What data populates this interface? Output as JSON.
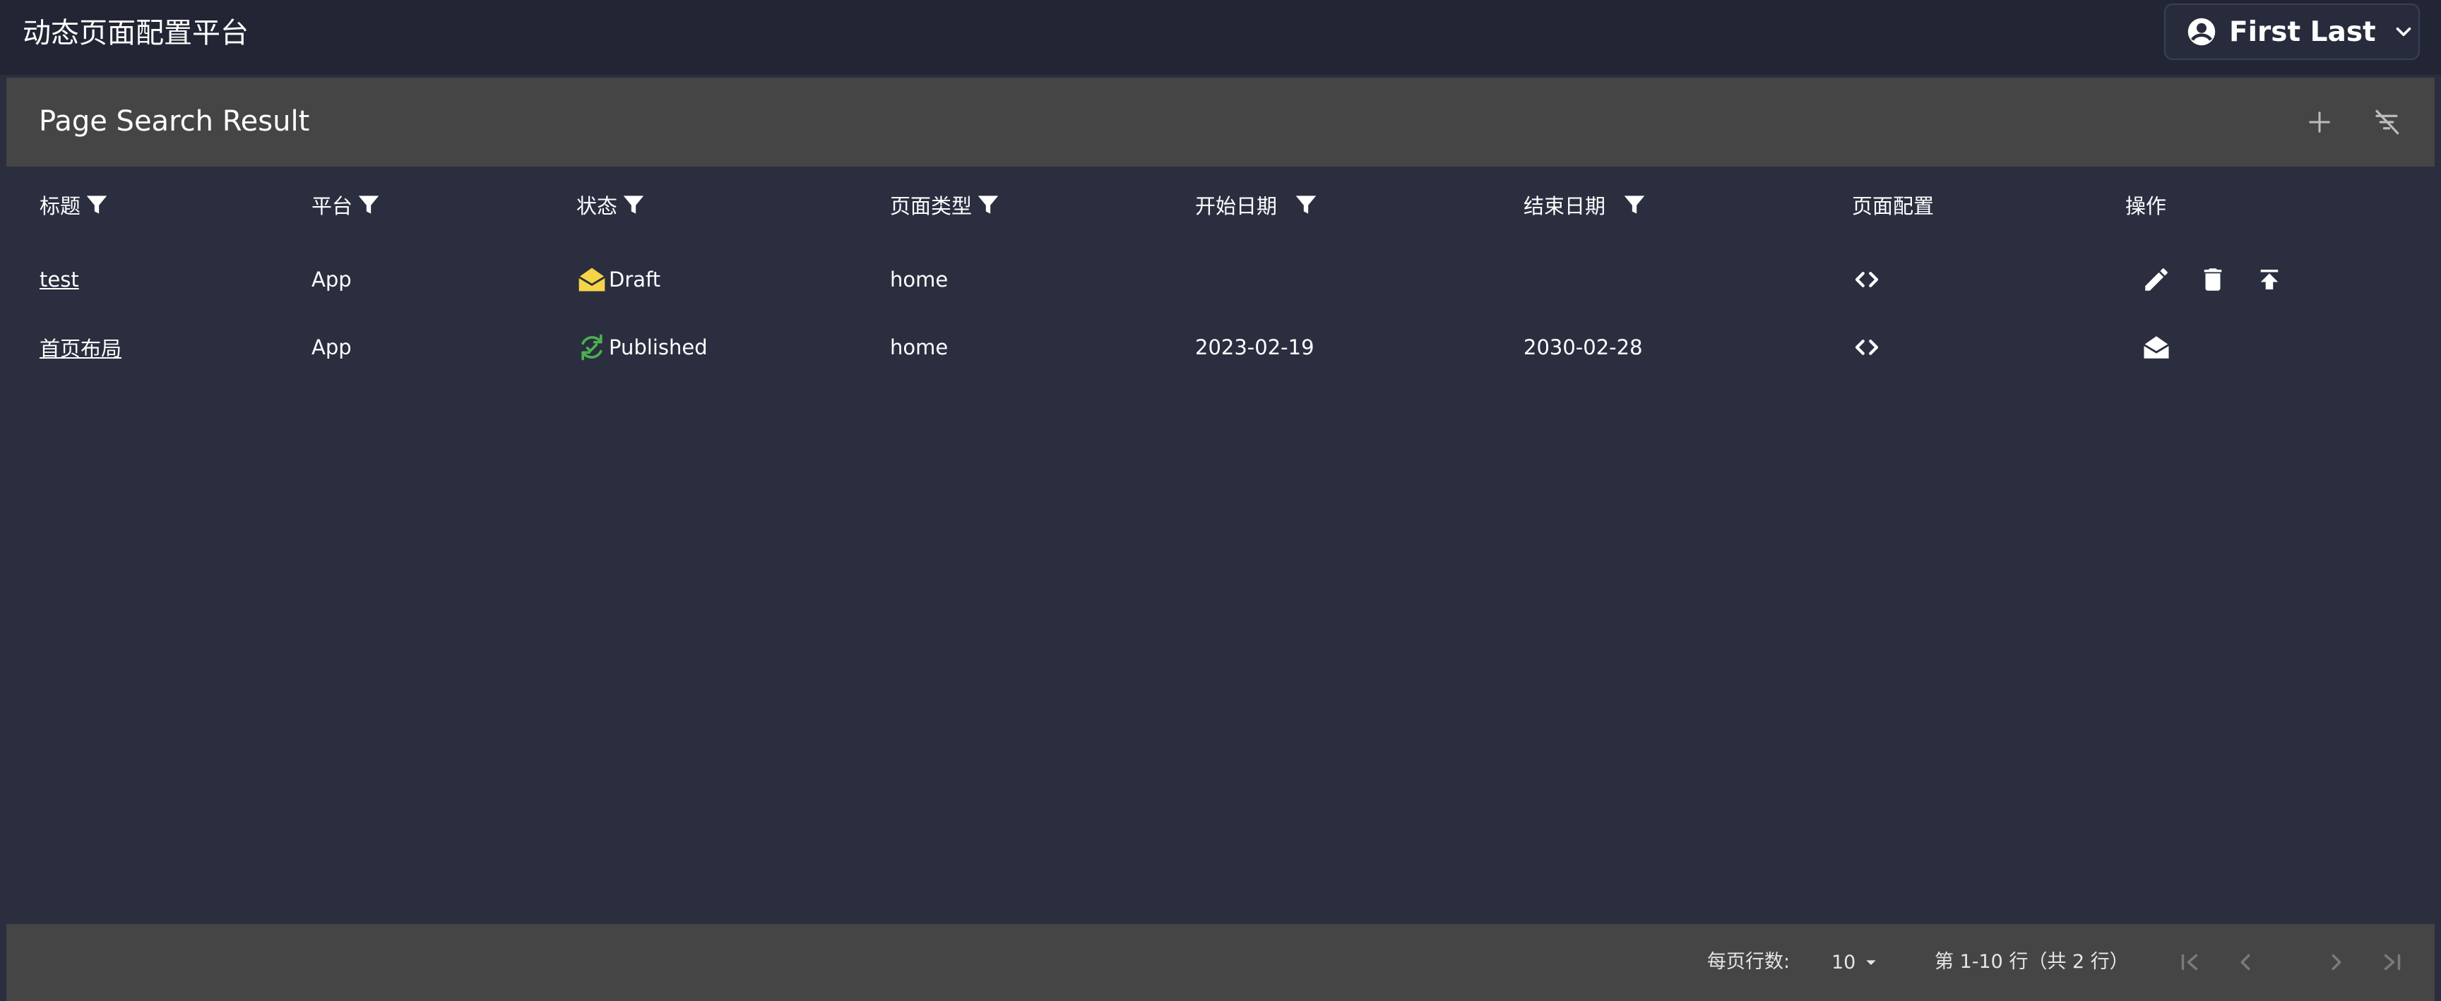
{
  "app": {
    "title": "动态页面配置平台",
    "user_name": "First Last"
  },
  "card": {
    "title": "Page Search Result",
    "add_icon": "plus-icon",
    "clear_filter_icon": "filter-off-icon"
  },
  "table": {
    "headers": [
      "标题",
      "平台",
      "状态",
      "页面类型",
      "开始日期",
      "结束日期",
      "页面配置",
      "操作"
    ],
    "rows": [
      {
        "title": "test",
        "platform": "App",
        "status": "Draft",
        "status_icon": "draft-envelope-icon",
        "status_color": "#f5d547",
        "page_type": "home",
        "start_date": "",
        "end_date": "",
        "config_icon": "code-icon",
        "actions": [
          "edit-icon",
          "delete-icon",
          "publish-icon"
        ]
      },
      {
        "title": "首页布局",
        "platform": "App",
        "status": "Published",
        "status_icon": "published-sync-icon",
        "status_color": "#4caf50",
        "page_type": "home",
        "start_date": "2023-02-19",
        "end_date": "2030-02-28",
        "config_icon": "code-icon",
        "actions": [
          "unpublish-envelope-icon"
        ]
      }
    ]
  },
  "pagination": {
    "rows_per_page_label": "每页行数:",
    "rows_per_page_value": "10",
    "range_label": "第 1-10 行（共 2 行）"
  },
  "colors": {
    "background": "#2a2e3f",
    "topbar": "#222533",
    "panel": "#454545",
    "draft": "#f5d547",
    "published": "#4caf50"
  }
}
